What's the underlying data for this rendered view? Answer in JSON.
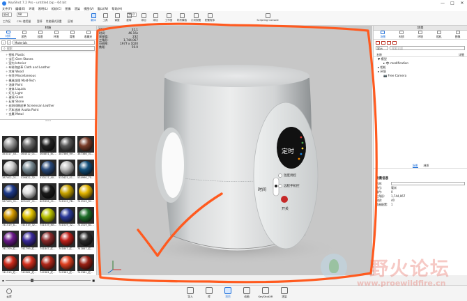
{
  "window": {
    "title": "KeyShot 7.2 Pro - untitled.bip - 64 bit",
    "controls": [
      "—",
      "□",
      "✕"
    ]
  },
  "menu": [
    "文件(F)",
    "编辑(E)",
    "环境",
    "照明(L)",
    "相机(C)",
    "图像",
    "渲染",
    "视图(V)",
    "窗口(W)",
    "帮助(H)"
  ],
  "toolbar": {
    "workspace_select": "启动",
    "cpu_select": "98",
    "workspace_label": "工作区",
    "cpu_label": "CPU 使用量",
    "pause_label": "暂停",
    "perf_label": "性能模式",
    "gpu_label": "双重",
    "region_label": "区域",
    "degree_select": "50.0",
    "tools": [
      {
        "label": "翻译",
        "active": true
      },
      {
        "label": "工具"
      },
      {
        "label": "调整"
      },
      {
        "label": "旋转"
      },
      {
        "label": "添加"
      },
      {
        "label": "添加"
      },
      {
        "label": "工作室"
      },
      {
        "label": "材质模板"
      },
      {
        "label": "几何视图"
      },
      {
        "label": "配置程序"
      },
      {
        "label": "Scripting Console"
      }
    ]
  },
  "library": {
    "title": "材质",
    "tabs": [
      {
        "label": "材质",
        "active": true
      },
      {
        "label": "颜色"
      },
      {
        "label": "纹理"
      },
      {
        "label": "环境"
      },
      {
        "label": "背景"
      },
      {
        "label": "收藏夹"
      }
    ],
    "path": "Materials",
    "search_placeholder": "搜索",
    "tree": [
      "塑料 Plastic",
      "宝石 Gem Stones",
      "室内 Interior",
      "布料和皮革 Cloth and Leather",
      "木材 Wood",
      "杂项 Miscellaneous",
      "模具纹理 Mold-Tech",
      "油漆 Paint",
      "液体 Liquids",
      "灯光 Light",
      "玻璃 Glass",
      "石材 Stone",
      "丝网印刷皮革 Screensan Leather",
      "汽车油漆 Axalta Paint",
      "金属 Metal"
    ],
    "materials": [
      {
        "name": "353317_40...",
        "color": "#9a9a9a"
      },
      {
        "name": "364512_01...",
        "color": "#6a6a6a"
      },
      {
        "name": "364651_BC...",
        "color": "#222222"
      },
      {
        "name": "387366_RH...",
        "color": "#5a5a5a"
      },
      {
        "name": "387366_01...",
        "color": "#7a3d2a"
      },
      {
        "name": "387402_01...",
        "color": "#cfcfcf"
      },
      {
        "name": "526822_32...",
        "color": "#7b8d96"
      },
      {
        "name": "533117_40...",
        "color": "#2a4a7a"
      },
      {
        "name": "533425_01...",
        "color": "#bdbdbd"
      },
      {
        "name": "534990_75...",
        "color": "#134f7a"
      },
      {
        "name": "567403_01...",
        "color": "#1e3a8a"
      },
      {
        "name": "605167_01...",
        "color": "#e0e0e0"
      },
      {
        "name": "605356_01...",
        "color": "#1a1a1a"
      },
      {
        "name": "741519_PB...",
        "color": "#c9a400"
      },
      {
        "name": "741519_RC...",
        "color": "#e3b500"
      },
      {
        "name": "741519_B...",
        "color": "#d39a00"
      },
      {
        "name": "741519_32...",
        "color": "#e0c200"
      },
      {
        "name": "741519_NB...",
        "color": "#b8c200"
      },
      {
        "name": "741519_32...",
        "color": "#2b3a9a"
      },
      {
        "name": "741519_BC...",
        "color": "#1f6f2a"
      },
      {
        "name": "741709_红...",
        "color": "#6a1a8a"
      },
      {
        "name": "741799_红...",
        "color": "#3a2a9a"
      },
      {
        "name": "741847_红...",
        "color": "#8a2a2a"
      },
      {
        "name": "741847_红...",
        "color": "#c0201a"
      },
      {
        "name": "741847_红...",
        "color": "#2a2a2a"
      },
      {
        "name": "741519_红...",
        "color": "#cc2a1a"
      },
      {
        "name": "742381_红...",
        "color": "#d4301e"
      },
      {
        "name": "742381_红...",
        "color": "#b0281a"
      },
      {
        "name": "742381_红...",
        "color": "#e04020"
      },
      {
        "name": "742381_红...",
        "color": "#992014"
      }
    ]
  },
  "viewport": {
    "hud": [
      {
        "k": "FPS:",
        "v": "31.1"
      },
      {
        "k": "时间:",
        "v": "46.16s"
      },
      {
        "k": "采样值:",
        "v": "232"
      },
      {
        "k": "三角形:",
        "v": "1,744,067"
      },
      {
        "k": "分辨率:",
        "v": "1977 x 1020"
      },
      {
        "k": "焦距:",
        "v": "50.0"
      }
    ],
    "panel_text": {
      "center": "定时",
      "left_label": "时间",
      "power": "开关",
      "btn1": "温度调控",
      "btn2": "远程手机控"
    }
  },
  "scene": {
    "title": "场景",
    "tabs": [
      {
        "label": "场景",
        "active": true
      },
      {
        "label": "材质"
      },
      {
        "label": "环境"
      },
      {
        "label": "相机"
      },
      {
        "label": "图像"
      }
    ],
    "filter_select": "显示",
    "search_placeholder": "搜索全部",
    "col_name": "名称",
    "col_detail": "详细",
    "tree": [
      {
        "label": "▼ 模型",
        "indent": 0
      },
      {
        "label": "▸ 👁 modification",
        "indent": 2
      },
      {
        "label": "▸ 相机",
        "indent": 0
      },
      {
        "label": "▸ 环境",
        "indent": 0
      },
      {
        "label": "📷 Free Camera",
        "indent": 2
      }
    ],
    "prop_tabs": [
      {
        "label": "场景",
        "active": true
      },
      {
        "label": "材质"
      }
    ],
    "props": {
      "header": "场景信息",
      "rows": [
        {
          "k": "名称:",
          "v": "",
          "boxed": true
        },
        {
          "k": "单位:",
          "v": "毫米"
        },
        {
          "k": "部件:",
          "v": "0"
        },
        {
          "k": "三角形:",
          "v": "1,744,067"
        },
        {
          "k": "材质:",
          "v": "40"
        },
        {
          "k": "动画配置:",
          "v": "1"
        }
      ]
    }
  },
  "bottom": {
    "cloud_label": "云库",
    "buttons": [
      {
        "label": "导入"
      },
      {
        "label": "库"
      },
      {
        "label": "项目",
        "active": true
      },
      {
        "label": "动画"
      },
      {
        "label": "KeyShotXR"
      },
      {
        "label": "渲染"
      }
    ]
  },
  "watermark": {
    "text": "野火论坛",
    "url": "www.proewildfire.cn"
  },
  "colors": {
    "accent": "#1e6fd9",
    "annotation": "#ff5a1f"
  }
}
